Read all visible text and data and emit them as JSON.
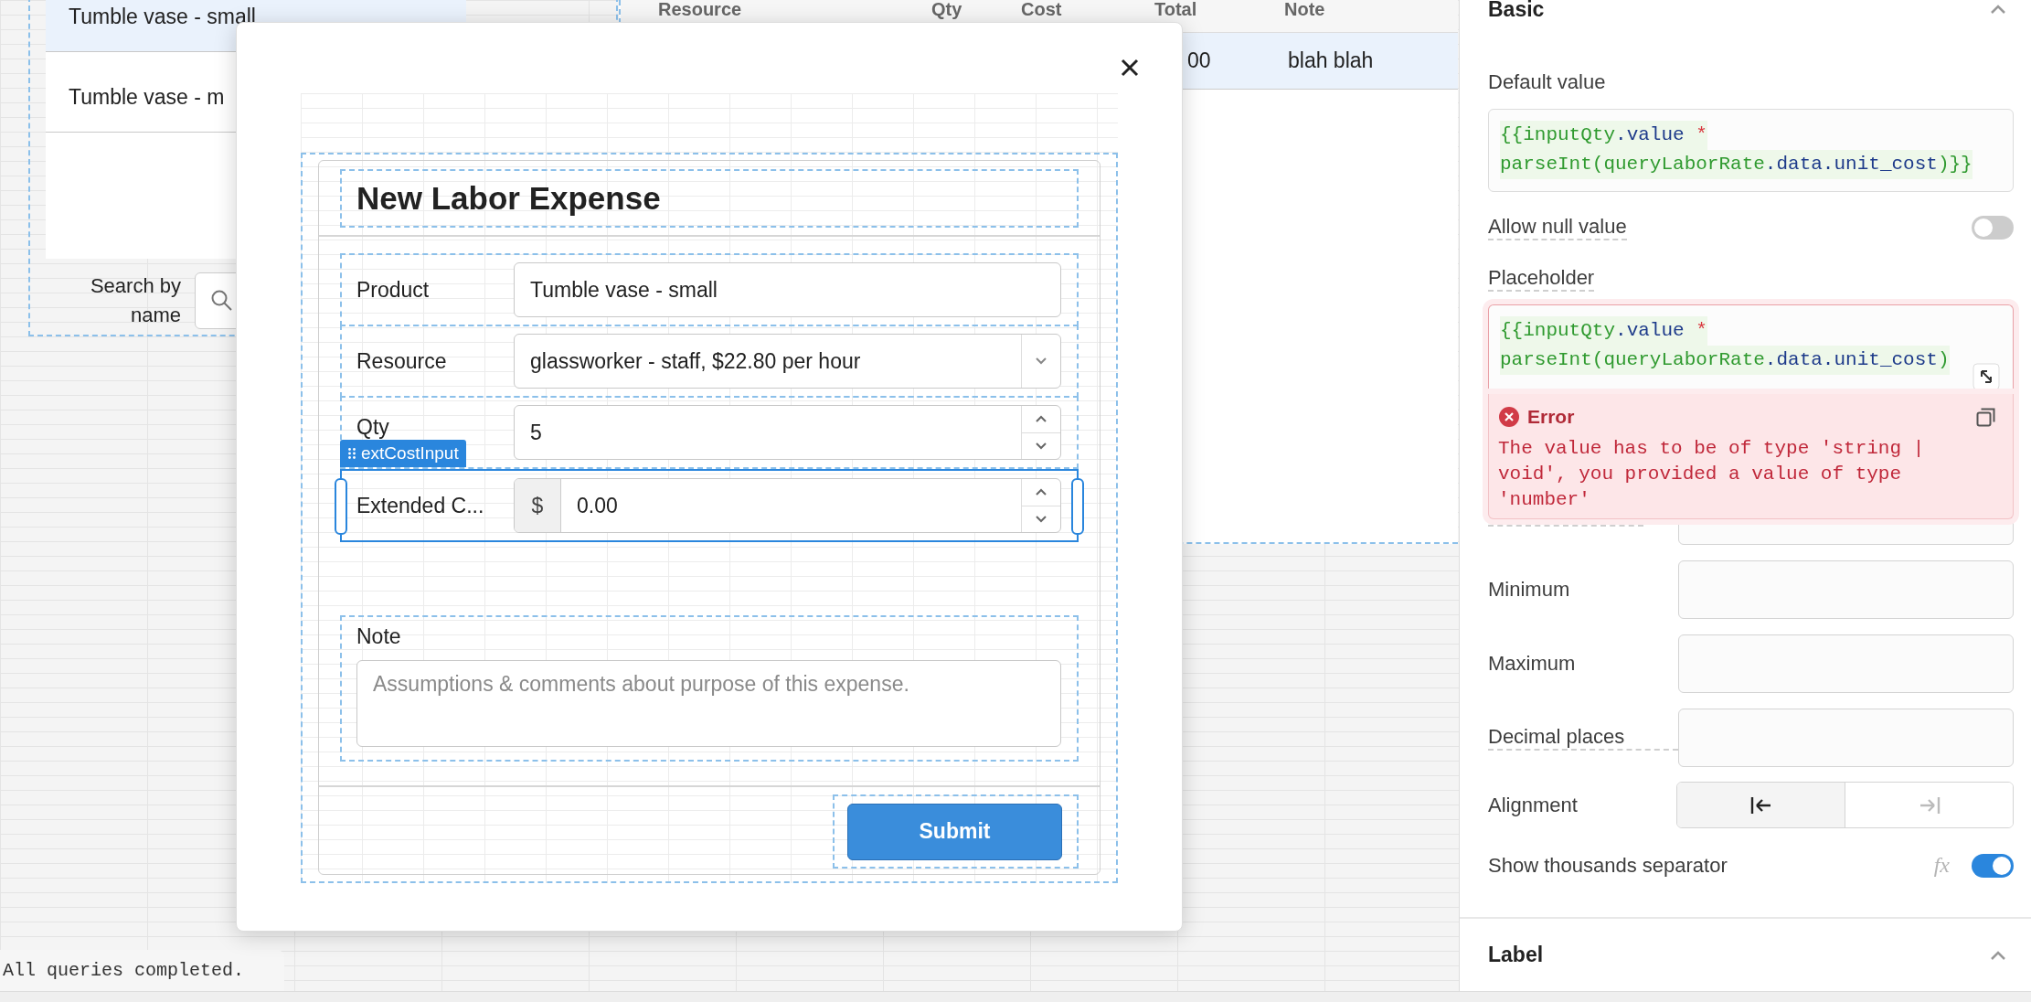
{
  "canvas": {
    "list": {
      "rows": [
        {
          "label": "Tumble vase - small",
          "selected": true
        },
        {
          "label": "Tumble vase - m",
          "selected": false
        }
      ]
    },
    "search": {
      "label": "Search by name"
    },
    "table": {
      "columns": [
        "Resource",
        "Qty",
        "Cost",
        "Total",
        "Note"
      ],
      "rows": [
        {
          "total": "00",
          "note": "blah blah",
          "selected": true
        }
      ]
    },
    "status_message": "All queries completed."
  },
  "modal": {
    "form": {
      "title": "New Labor Expense",
      "fields": [
        {
          "kind": "text",
          "label": "Product",
          "value": "Tumble vase - small",
          "selected": false
        },
        {
          "kind": "select",
          "label": "Resource",
          "value": "glassworker - staff, $22.80 per hour",
          "selected": false
        },
        {
          "kind": "number",
          "label": "Qty",
          "value": "5",
          "selected": false
        },
        {
          "kind": "currency",
          "label": "Extended C...",
          "prefix": "$",
          "value": "0.00",
          "selected": true,
          "tag": "extCostInput"
        },
        {
          "kind": "textarea",
          "label": "Note",
          "placeholder": "Assumptions & comments about purpose of this expense.",
          "selected": false
        }
      ],
      "submit": "Submit"
    }
  },
  "inspector": {
    "section": {
      "title": "Basic",
      "expanded": true
    },
    "default_value": {
      "label": "Default value",
      "has_tooltip": false,
      "code": [
        [
          {
            "text": "{{inputQty",
            "kind": "name"
          },
          {
            "text": ".value",
            "kind": "prop"
          },
          {
            "text": " *",
            "kind": "op"
          }
        ],
        [
          {
            "text": "parseInt(queryLaborRate",
            "kind": "name"
          },
          {
            "text": ".data.unit_cost",
            "kind": "prop"
          },
          {
            "text": ")}}",
            "kind": "name"
          }
        ]
      ]
    },
    "allow_null": {
      "label": "Allow null value",
      "has_tooltip": true,
      "on": false
    },
    "placeholder": {
      "label": "Placeholder",
      "has_tooltip": true,
      "code": [
        [
          {
            "text": "{{inputQty",
            "kind": "name"
          },
          {
            "text": ".value",
            "kind": "prop"
          },
          {
            "text": " *",
            "kind": "op"
          }
        ],
        [
          {
            "text": "parseInt(queryLaborRate",
            "kind": "name"
          },
          {
            "text": ".data.unit_cost",
            "kind": "prop"
          },
          {
            "text": ")",
            "kind": "name"
          }
        ]
      ],
      "error": {
        "title": "Error",
        "message": "The value has to be of type 'string | void', you provided a value of type 'number'"
      }
    },
    "fields": [
      {
        "label": "Minimum",
        "has_tooltip": false
      },
      {
        "label": "Maximum",
        "has_tooltip": false
      },
      {
        "label": "Decimal places",
        "has_tooltip": true
      }
    ],
    "alignment": {
      "label": "Alignment",
      "options": [
        {
          "kind": "left",
          "selected": true
        },
        {
          "kind": "right",
          "selected": false
        }
      ]
    },
    "thousands": {
      "label": "Show thousands separator",
      "formula": "fx",
      "on": true
    },
    "next_section": {
      "title": "Label",
      "expanded": true
    }
  }
}
